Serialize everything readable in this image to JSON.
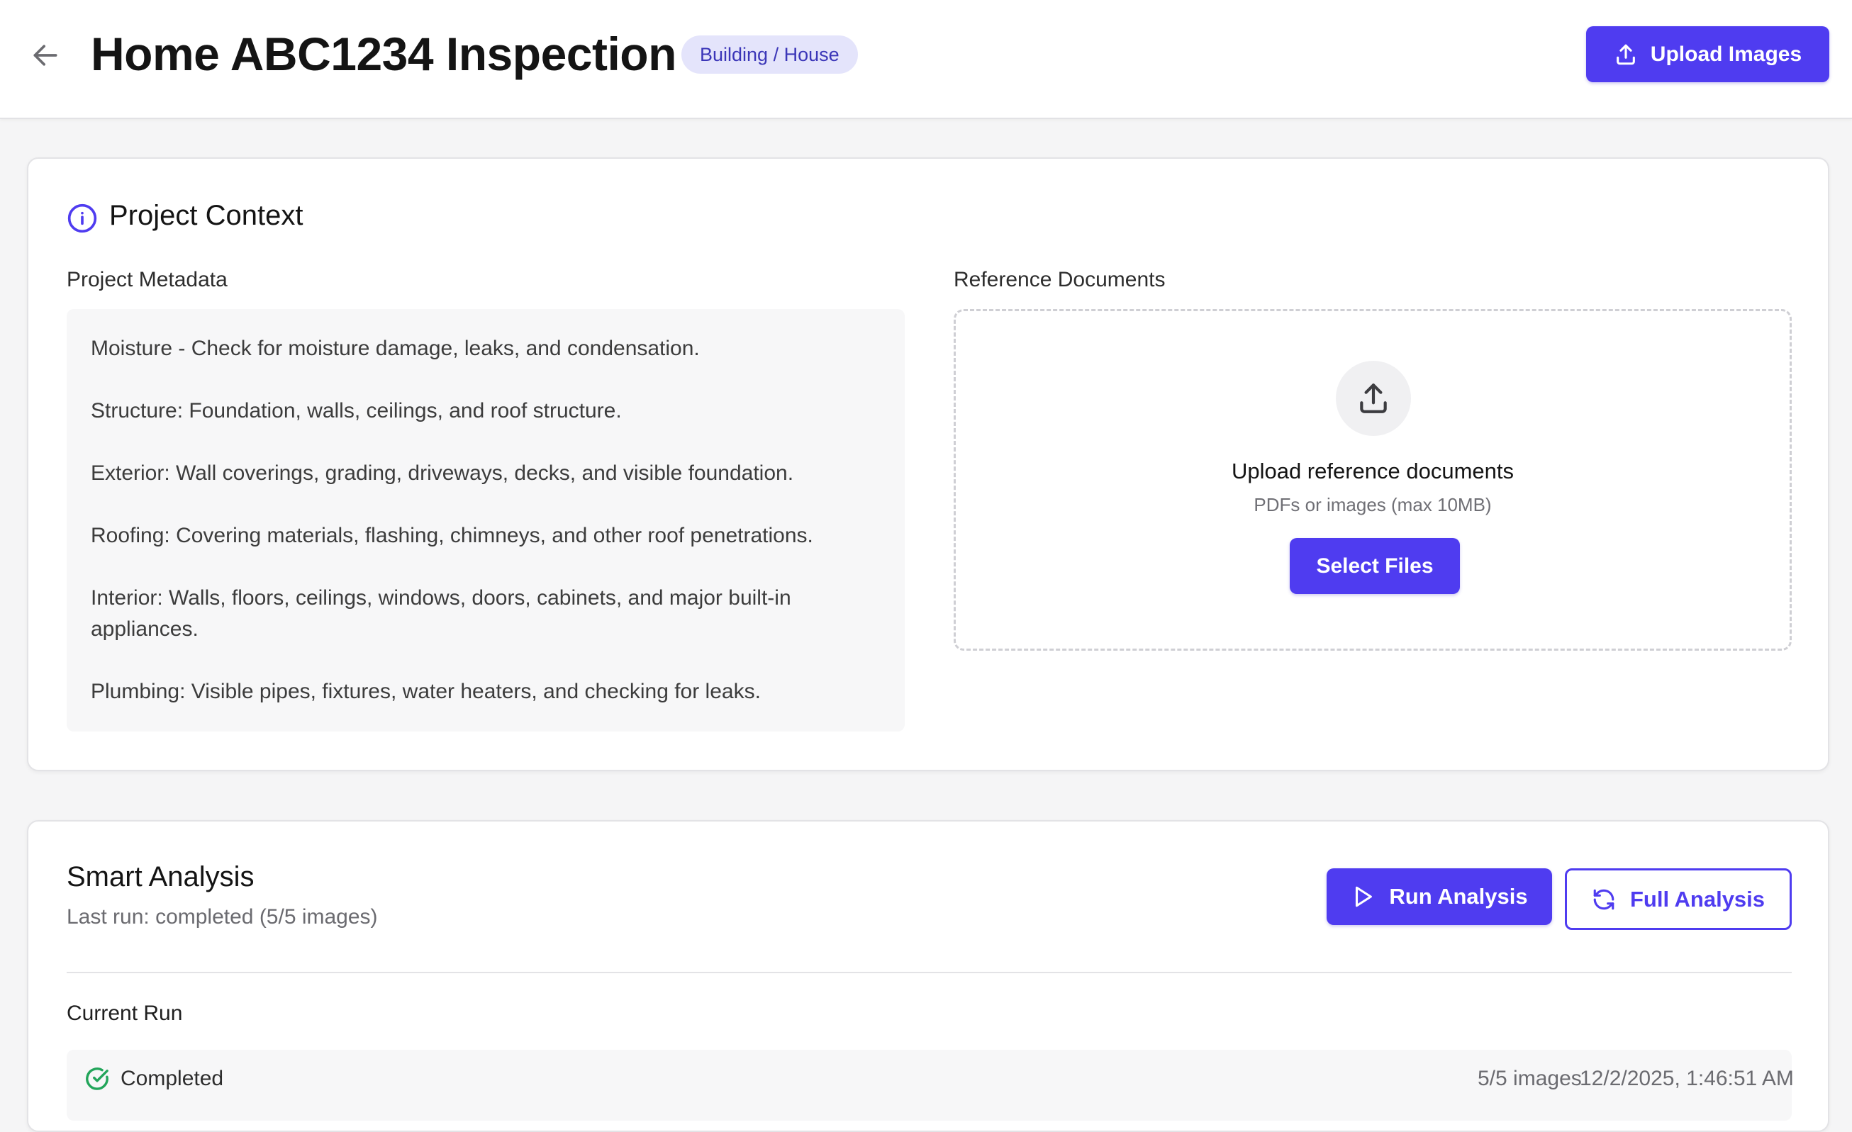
{
  "header": {
    "title": "Home ABC1234 Inspection",
    "badge": "Building / House",
    "upload_label": "Upload Images"
  },
  "context": {
    "title": "Project Context",
    "metadata_label": "Project Metadata",
    "metadata_items": [
      "Moisture - Check for moisture damage, leaks, and condensation.",
      "Structure: Foundation, walls, ceilings, and roof structure.",
      "Exterior: Wall coverings, grading, driveways, decks, and visible foundation.",
      "Roofing: Covering materials, flashing, chimneys, and other roof penetrations.",
      "Interior: Walls, floors, ceilings, windows, doors, cabinets, and major built-in appliances.",
      "Plumbing: Visible pipes, fixtures, water heaters, and checking for leaks."
    ],
    "reference_label": "Reference Documents",
    "upload_title": "Upload reference documents",
    "upload_hint": "PDFs or images (max 10MB)",
    "select_label": "Select Files"
  },
  "analysis": {
    "title": "Smart Analysis",
    "last_run": "Last run: completed (5/5 images)",
    "run_label": "Run Analysis",
    "full_label": "Full Analysis",
    "current_run_label": "Current Run",
    "current_run": {
      "status": "Completed",
      "images": "5/5 images",
      "timestamp": "12/2/2025, 1:46:51 AM"
    }
  },
  "colors": {
    "accent": "#4f3cf0",
    "badge_bg": "#e4e4fb",
    "success": "#22a55a",
    "info_icon": "#4f3cf0"
  },
  "icons": {
    "back": "arrow-left-icon",
    "upload": "upload-icon",
    "info": "info-circle-icon",
    "play": "play-icon",
    "refresh": "refresh-icon",
    "check": "check-circle-icon"
  }
}
